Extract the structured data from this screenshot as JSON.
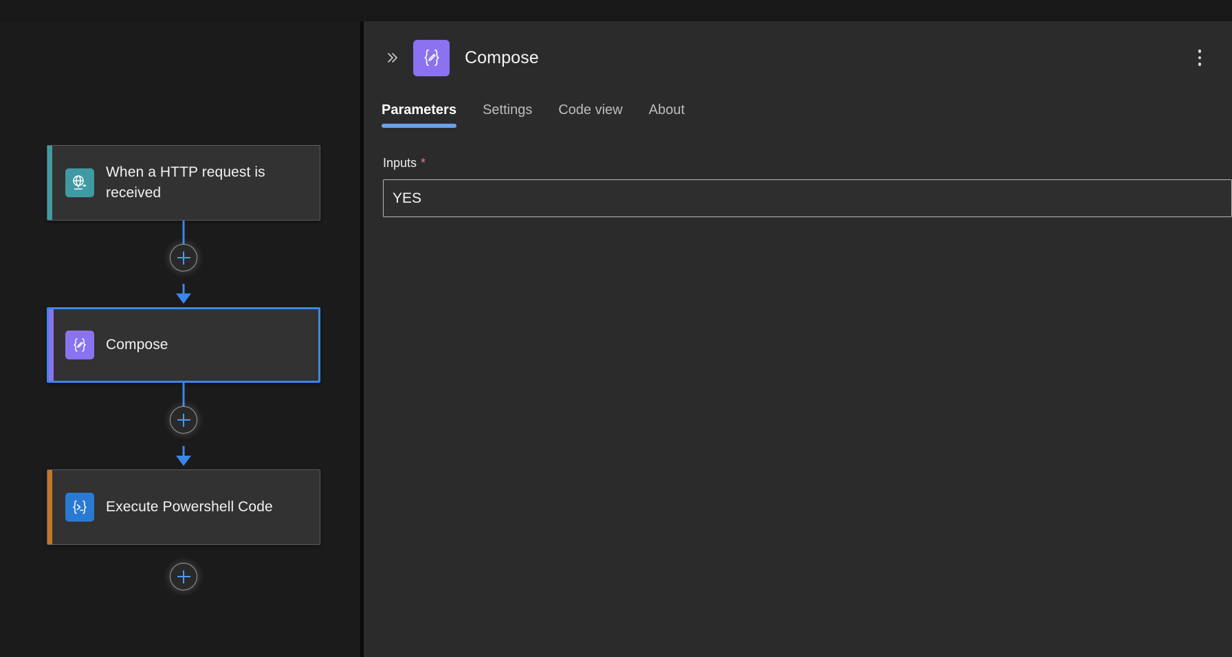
{
  "app": {
    "background": "#1b1b1b",
    "panel_background": "#2b2b2b",
    "accent_blue": "#3b87e8"
  },
  "canvas": {
    "nodes": [
      {
        "id": "http-trigger",
        "label": "When a HTTP request is received",
        "icon": "globe-arrow-icon",
        "icon_tile_color": "#3f9aa3",
        "accent_color": "#3f9aa3",
        "selected": false
      },
      {
        "id": "compose",
        "label": "Compose",
        "icon": "braces-pencil-icon",
        "icon_tile_color": "#8b72f0",
        "accent_color": "#8b72f0",
        "selected": true
      },
      {
        "id": "execute-powershell-code",
        "label": "Execute Powershell Code",
        "icon": "braces-terminal-icon",
        "icon_tile_color": "#2a7ad4",
        "accent_color": "#c4752a",
        "selected": false
      }
    ],
    "add_step_buttons": [
      {
        "id": "add-step-1",
        "icon": "plus-icon",
        "tooltip": "Insert a new step"
      },
      {
        "id": "add-step-2",
        "icon": "plus-icon",
        "tooltip": "Insert a new step"
      },
      {
        "id": "add-step-3",
        "icon": "plus-icon",
        "tooltip": "Insert a new step"
      }
    ]
  },
  "panel": {
    "collapse_icon": "chevron-double-right-icon",
    "icon": "braces-pencil-icon",
    "icon_tile_color": "#8b72f0",
    "title": "Compose",
    "menu_icon": "more-vertical-icon",
    "tabs": [
      {
        "label": "Parameters",
        "active": true
      },
      {
        "label": "Settings",
        "active": false
      },
      {
        "label": "Code view",
        "active": false
      },
      {
        "label": "About",
        "active": false
      }
    ],
    "fields": [
      {
        "label": "Inputs",
        "required": true,
        "required_marker": "*",
        "value": "YES",
        "placeholder": ""
      }
    ]
  }
}
